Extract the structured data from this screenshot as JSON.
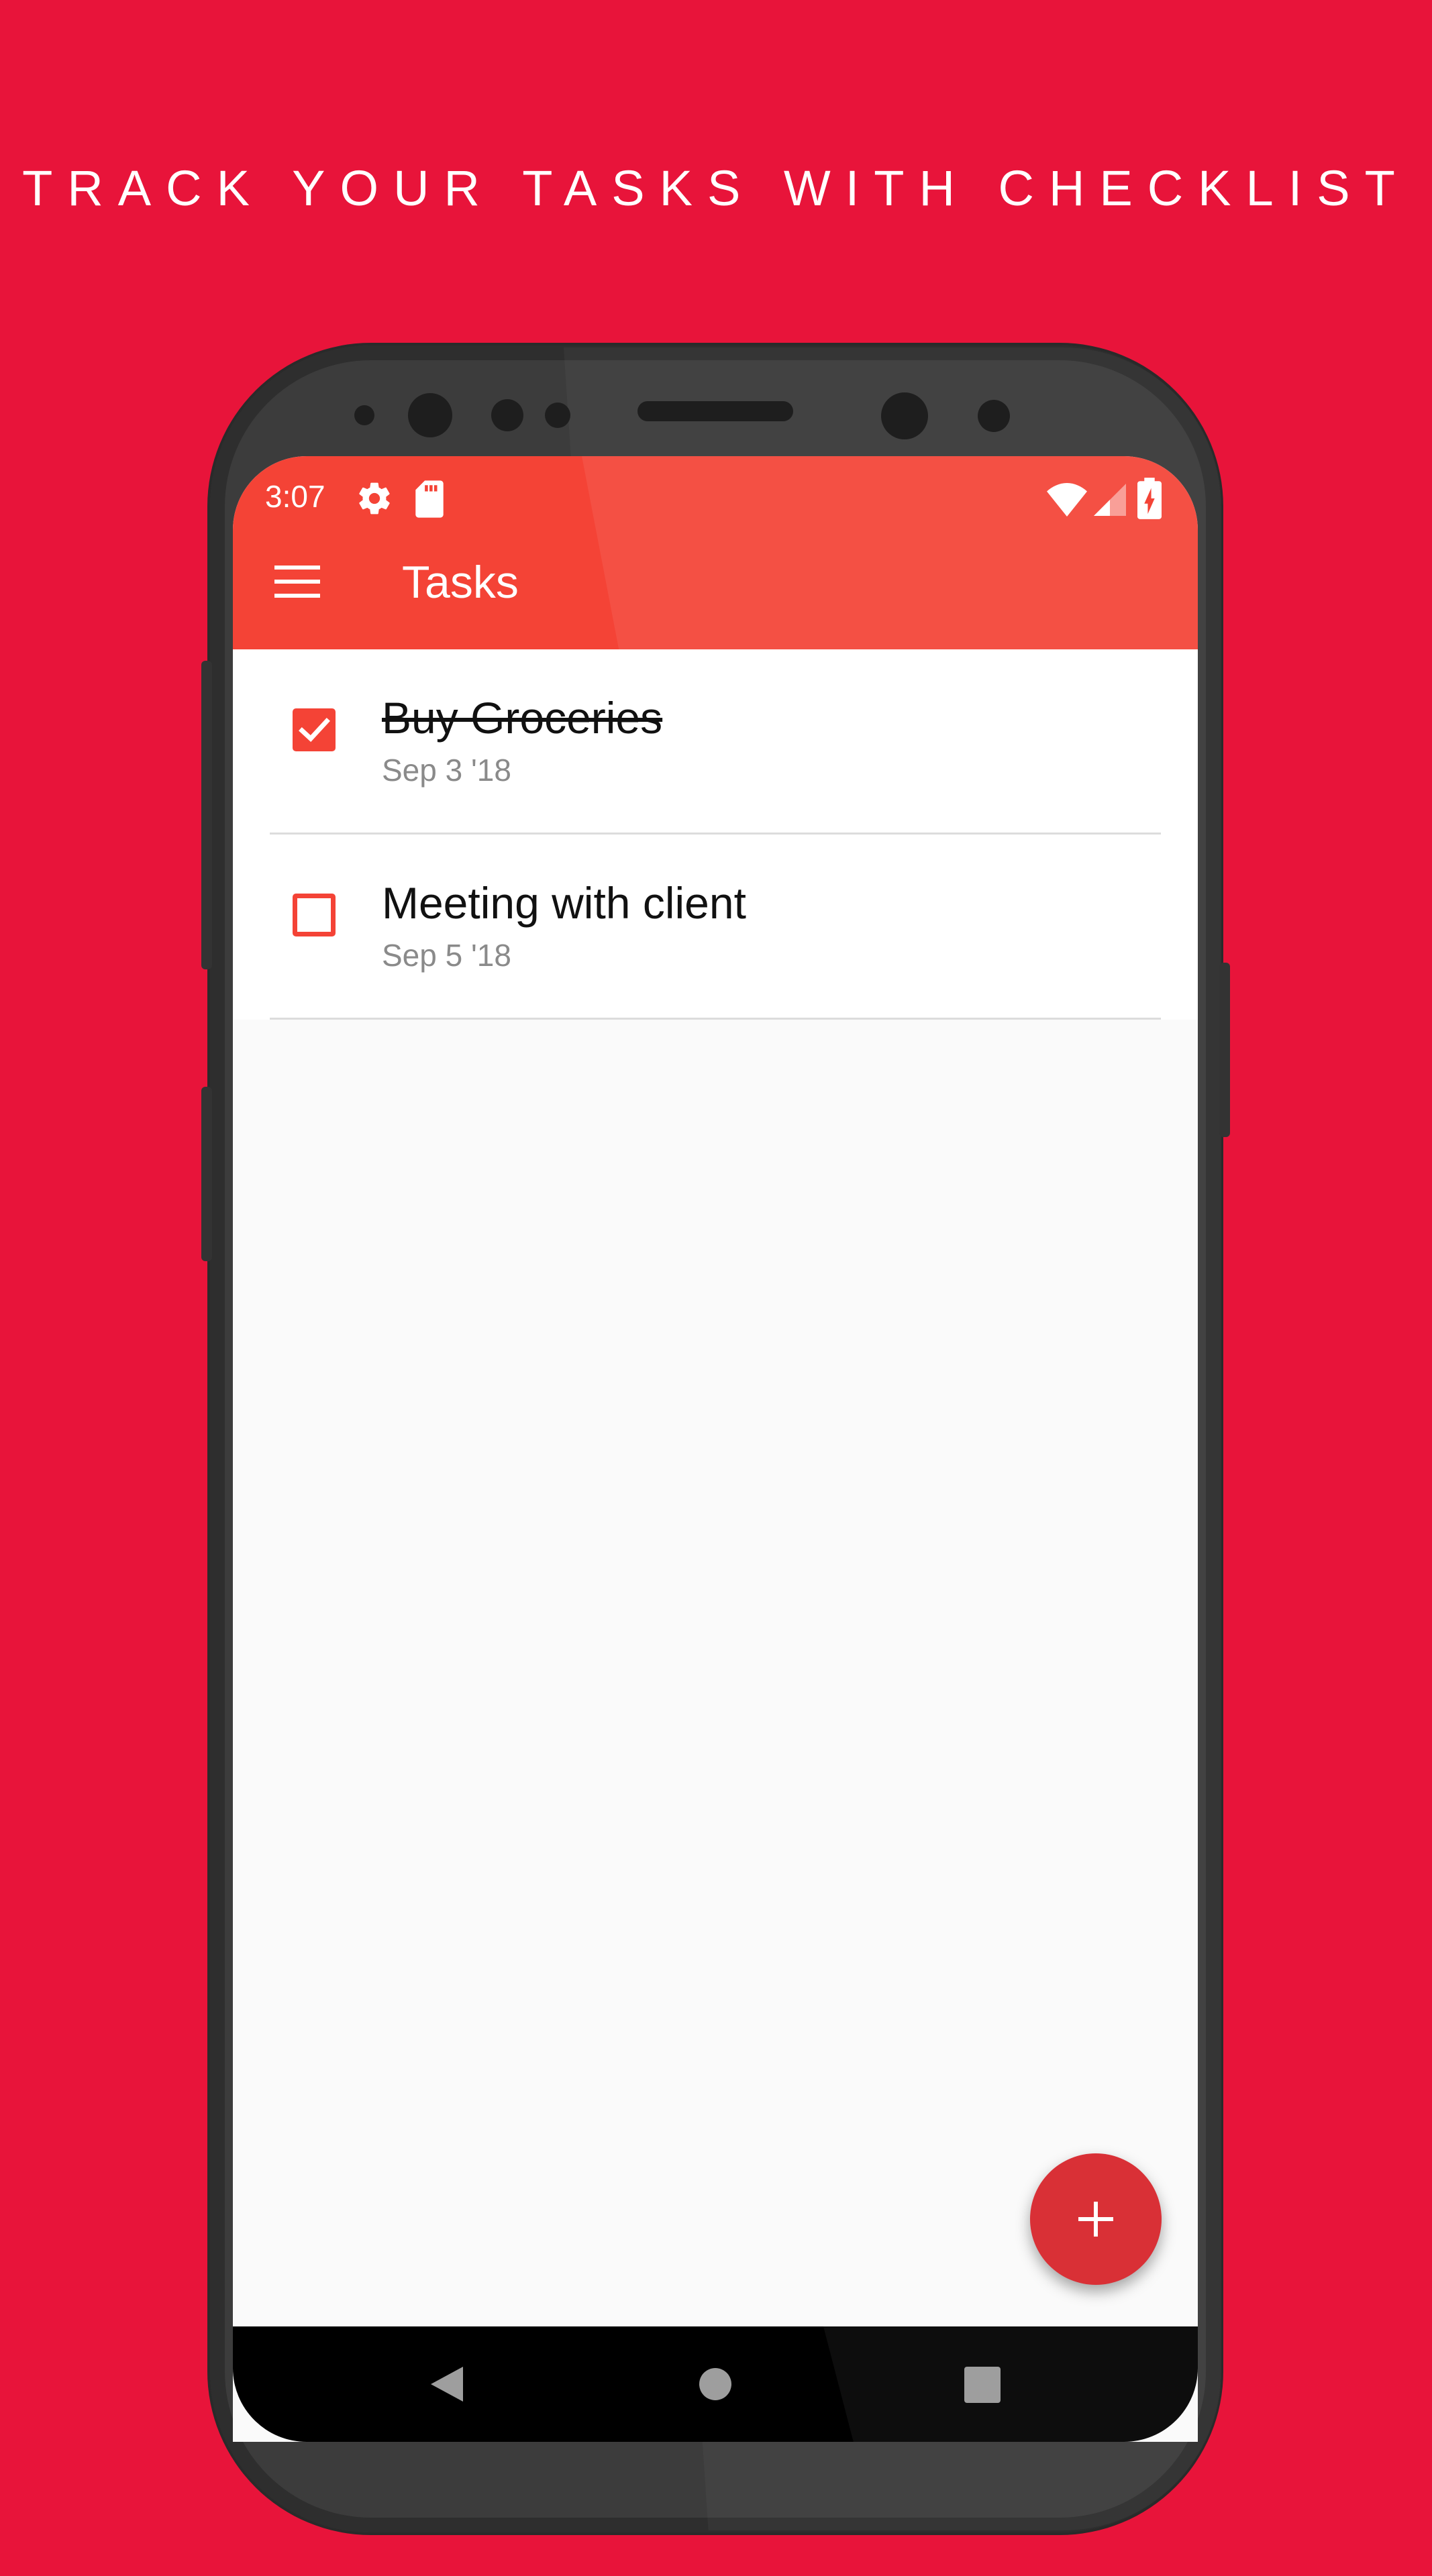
{
  "headline": "TRACK YOUR TASKS WITH CHECKLIST",
  "status_bar": {
    "time": "3:07",
    "icons": [
      "gear-icon",
      "sd-card-icon",
      "wifi-icon",
      "cell-signal-icon",
      "battery-charging-icon"
    ]
  },
  "app_bar": {
    "title": "Tasks",
    "menu_icon": "hamburger-menu-icon"
  },
  "tasks": [
    {
      "title": "Buy Groceries",
      "date": "Sep 3 '18",
      "completed": true
    },
    {
      "title": "Meeting with client",
      "date": "Sep 5 '18",
      "completed": false
    }
  ],
  "fab": {
    "icon": "plus-icon",
    "label": "+"
  },
  "nav_bar": {
    "icons": [
      "back-triangle-icon",
      "home-circle-icon",
      "recents-square-icon"
    ]
  },
  "colors": {
    "background": "#e8143a",
    "app_bar": "#f44336",
    "accent": "#f44336",
    "fab": "#d93036",
    "phone_body": "#3c3c3c",
    "nav_bar": "#000000",
    "content_bg": "#fafafa"
  }
}
